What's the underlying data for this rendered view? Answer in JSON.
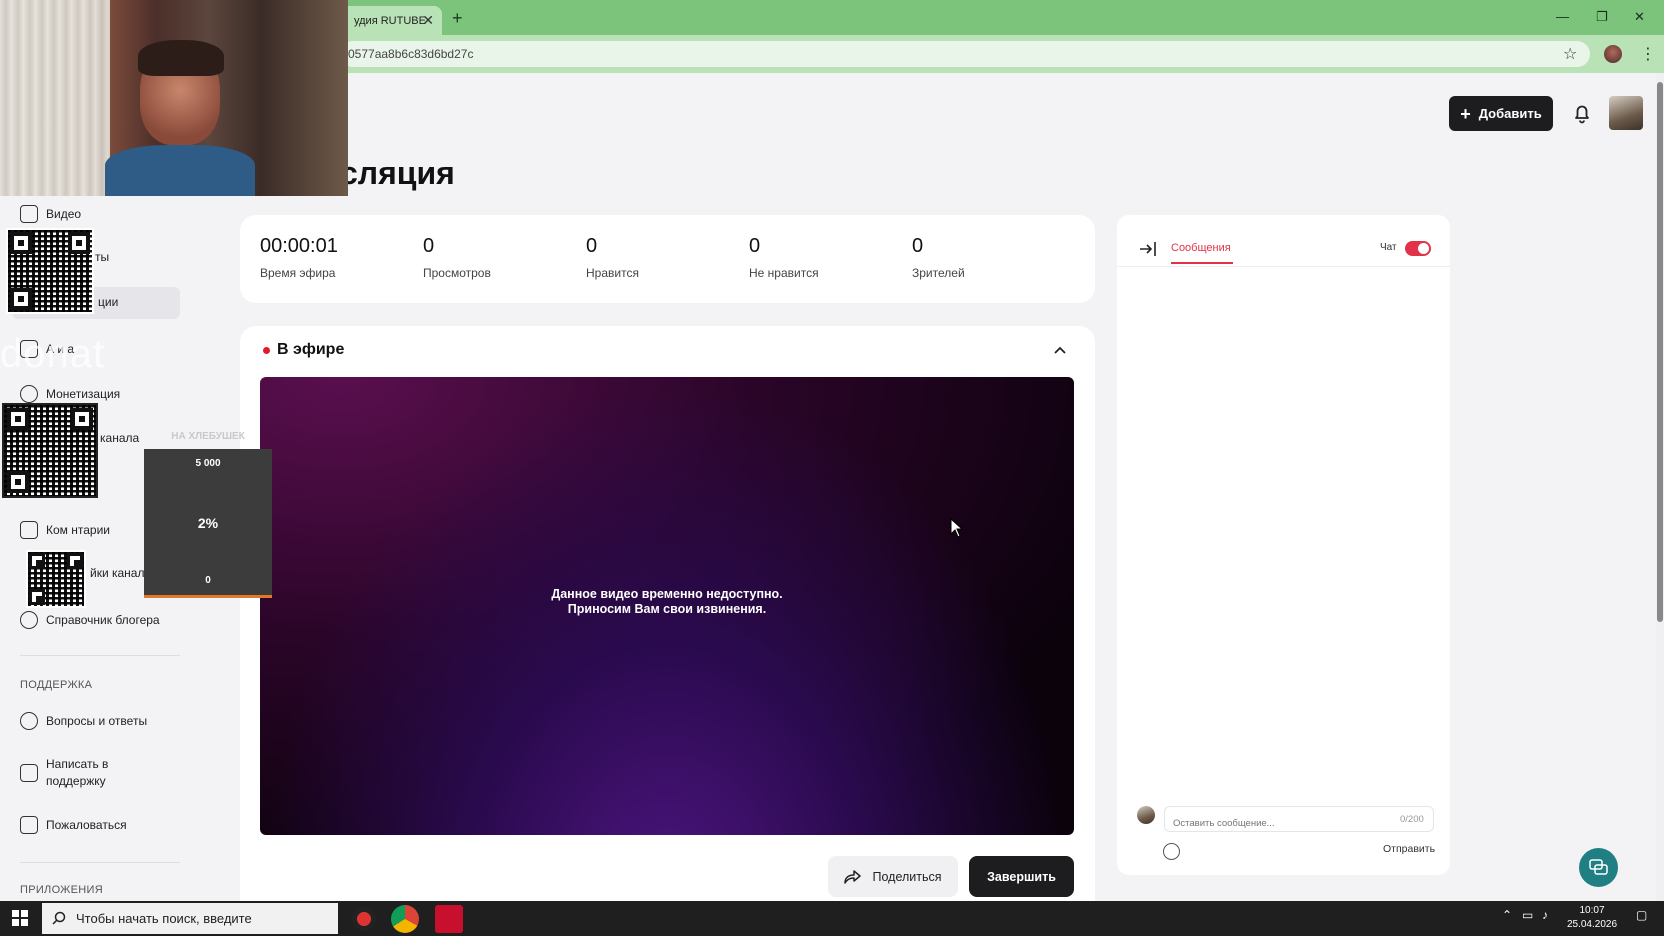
{
  "browser": {
    "tab_title": "удия RUTUBE",
    "url": "0577aa8b6c83d6bd27c"
  },
  "header": {
    "page_title": "сляция",
    "add_button": "Добавить"
  },
  "sidebar": {
    "items": [
      {
        "label": "Видео",
        "icon": "video-icon"
      },
      {
        "label": "ты",
        "icon": "playlist-icon"
      },
      {
        "label": "ции",
        "icon": "broadcast-icon"
      },
      {
        "label": "А   и   а",
        "icon": "analytics-icon"
      },
      {
        "label": "Монетизация",
        "icon": "ruble-icon"
      },
      {
        "label": "канала",
        "icon": "channel-icon"
      },
      {
        "label": "Ком  нтарии",
        "icon": "comments-icon"
      },
      {
        "label": "йки канал",
        "icon": "settings-icon"
      },
      {
        "label": "Справочник блогера",
        "icon": "info-icon"
      }
    ],
    "support_label": "ПОДДЕРЖКА",
    "support_items": [
      {
        "label": "Вопросы и ответы",
        "icon": "question-icon"
      },
      {
        "label": "Написать в поддержку",
        "icon": "mail-icon"
      },
      {
        "label": "Пожаловаться",
        "icon": "flag-icon"
      }
    ],
    "apps_label": "ПРИЛОЖЕНИЯ"
  },
  "stats": [
    {
      "value": "00:00:01",
      "label": "Время эфира"
    },
    {
      "value": "0",
      "label": "Просмотров"
    },
    {
      "value": "0",
      "label": "Нравится"
    },
    {
      "value": "0",
      "label": "Не нравится"
    },
    {
      "value": "0",
      "label": "Зрителей"
    }
  ],
  "live": {
    "title": "В эфире",
    "player_message_1": "Данное видео временно недоступно.",
    "player_message_2": "Приносим Вам свои извинения.",
    "share_button": "Поделиться",
    "end_button": "Завершить"
  },
  "chat": {
    "tab_label": "Сообщения",
    "toggle_label": "Чат",
    "toggle_on": true,
    "input_placeholder": "Оставить сообщение...",
    "counter": "0/200",
    "send_label": "Отправить"
  },
  "overlay": {
    "donat_text": "donat",
    "goal_title": "НА ХЛЕБУШЕК",
    "goal_max": "5 000",
    "goal_percent": "2%",
    "goal_min": "0"
  },
  "taskbar": {
    "search_placeholder": "Чтобы начать поиск, введите",
    "time": "10:07",
    "date": "25.04.2026"
  },
  "colors": {
    "accent_red": "#e0334a",
    "chrome_green": "#7cc47c",
    "dark_button": "#1d1d1f"
  }
}
